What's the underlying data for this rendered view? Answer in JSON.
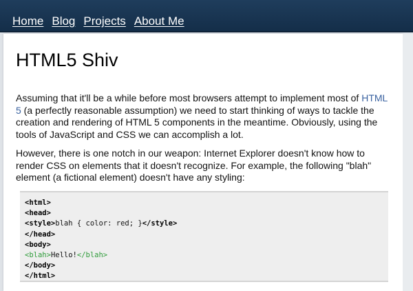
{
  "nav": {
    "items": [
      {
        "label": "Home"
      },
      {
        "label": "Blog"
      },
      {
        "label": "Projects"
      },
      {
        "label": "About Me"
      }
    ]
  },
  "article": {
    "title": "HTML5 Shiv",
    "para1_before": "Assuming that it'll be a while before most browsers attempt to implement most of ",
    "para1_link": "HTML 5",
    "para1_after": " (a perfectly reasonable assumption) we need to start thinking of ways to tackle the creation and rendering of HTML 5 components in the meantime. Obviously, using the tools of JavaScript and CSS we can accomplish a lot.",
    "para2": "However, there is one notch in our weapon: Internet Explorer doesn't know how to render CSS on elements that it doesn't recognize. For example, the following \"blah\" element (a fictional element) doesn't have any styling:"
  },
  "code": {
    "line1": "<html>",
    "line2": "<head>",
    "line3_open": "<style>",
    "line3_body": "blah { color: red; }",
    "line3_close": "</style>",
    "line4": "</head>",
    "line5": "<body>",
    "line6_open": "<blah>",
    "line6_text": "Hello!",
    "line6_close": "</blah>",
    "line7": "</body>",
    "line8": "</html>"
  },
  "colors": {
    "nav_background": "#1a3653",
    "link": "#3a62a0",
    "code_green": "#2f9c3a",
    "code_background": "#eeeeee"
  }
}
